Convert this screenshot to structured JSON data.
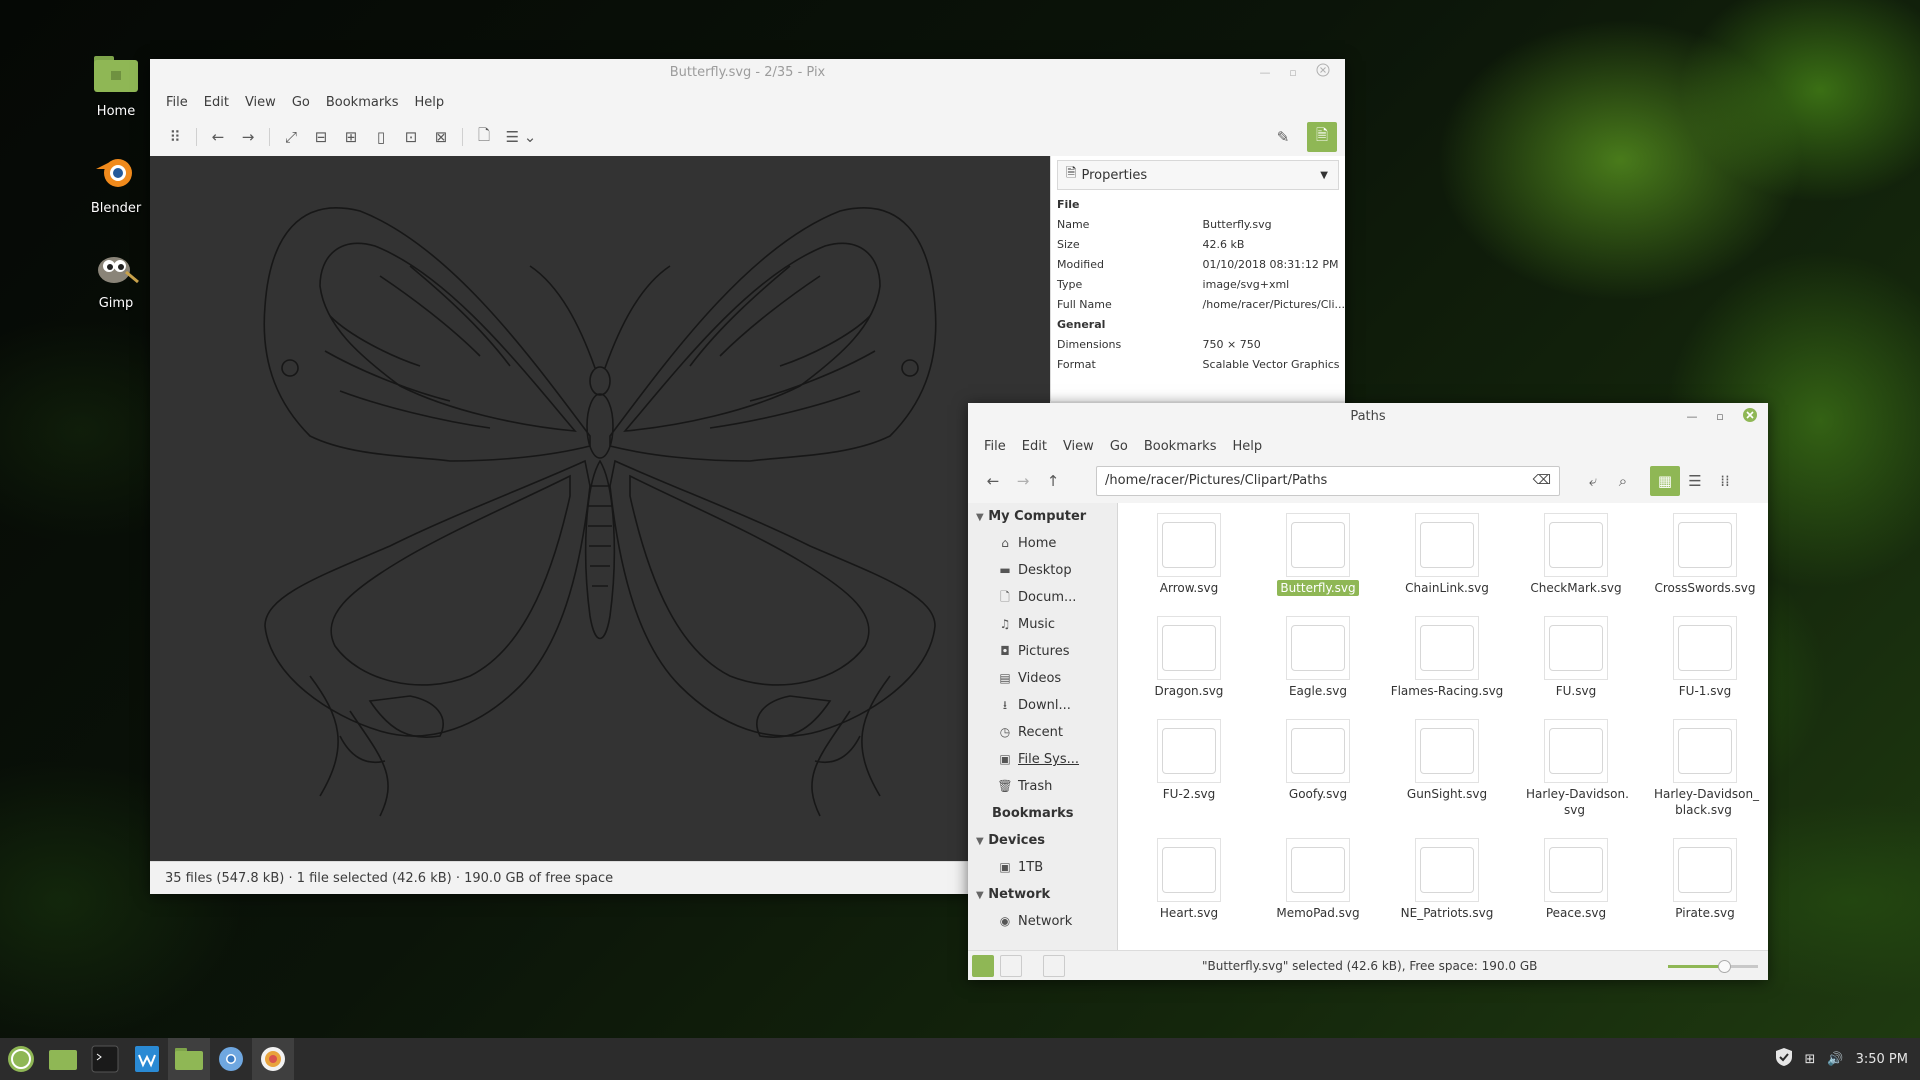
{
  "desktop": {
    "icons": [
      {
        "label": "Home",
        "icon": "home-folder-icon"
      },
      {
        "label": "Blender",
        "icon": "blender-icon"
      },
      {
        "label": "Gimp",
        "icon": "gimp-icon"
      }
    ]
  },
  "pix": {
    "title": "Butterfly.svg - 2/35 - Pix",
    "menu": [
      "File",
      "Edit",
      "View",
      "Go",
      "Bookmarks",
      "Help"
    ],
    "status": "35 files (547.8 kB) · 1 file selected (42.6 kB) · 190.0 GB of free space",
    "properties": {
      "header": "Properties",
      "rows": [
        {
          "section": "File"
        },
        {
          "key": "Name",
          "value": "Butterfly.svg"
        },
        {
          "key": "Size",
          "value": "42.6 kB"
        },
        {
          "key": "Modified",
          "value": "01/10/2018 08:31:12 PM"
        },
        {
          "key": "Type",
          "value": "image/svg+xml"
        },
        {
          "key": "Full Name",
          "value": "/home/racer/Pictures/Cli..."
        },
        {
          "section": "General"
        },
        {
          "key": "Dimensions",
          "value": "750 × 750"
        },
        {
          "key": "Format",
          "value": "Scalable Vector Graphics"
        }
      ]
    }
  },
  "nemo": {
    "title": "Paths",
    "menu": [
      "File",
      "Edit",
      "View",
      "Go",
      "Bookmarks",
      "Help"
    ],
    "path": "/home/racer/Pictures/Clipart/Paths",
    "sidebar": {
      "my_computer": "My Computer",
      "items": [
        {
          "label": "Home",
          "icon": "home-icon"
        },
        {
          "label": "Desktop",
          "icon": "desktop-icon"
        },
        {
          "label": "Docum...",
          "icon": "documents-icon"
        },
        {
          "label": "Music",
          "icon": "music-icon"
        },
        {
          "label": "Pictures",
          "icon": "camera-icon"
        },
        {
          "label": "Videos",
          "icon": "film-icon"
        },
        {
          "label": "Downl...",
          "icon": "download-icon"
        },
        {
          "label": "Recent",
          "icon": "clock-icon"
        },
        {
          "label": "File Sys...",
          "icon": "drive-icon"
        },
        {
          "label": "Trash",
          "icon": "trash-icon"
        }
      ],
      "bookmarks": "Bookmarks",
      "devices": "Devices",
      "device_items": [
        {
          "label": "1TB",
          "icon": "drive-icon"
        }
      ],
      "network": "Network",
      "network_items": [
        {
          "label": "Network",
          "icon": "network-icon"
        }
      ]
    },
    "files": [
      "Arrow.svg",
      "Butterfly.svg",
      "ChainLink.svg",
      "CheckMark.svg",
      "CrossSwords.svg",
      "Dragon.svg",
      "Eagle.svg",
      "Flames-Racing.svg",
      "FU.svg",
      "FU-1.svg",
      "FU-2.svg",
      "Goofy.svg",
      "GunSight.svg",
      "Harley-Davidson.\nsvg",
      "Harley-Davidson_\nblack.svg",
      "Heart.svg",
      "MemoPad.svg",
      "NE_Patriots.svg",
      "Peace.svg",
      "Pirate.svg"
    ],
    "selected_file": "Butterfly.svg",
    "status": "\"Butterfly.svg\" selected (42.6 kB), Free space: 190.0 GB",
    "zoom_level": 0.62
  },
  "taskbar": {
    "apps": [
      {
        "name": "mint-menu-icon"
      },
      {
        "name": "show-desktop-icon"
      },
      {
        "name": "terminal-icon"
      },
      {
        "name": "writer-icon"
      },
      {
        "name": "files-icon"
      },
      {
        "name": "chromium-icon"
      },
      {
        "name": "pix-icon"
      }
    ],
    "clock": "3:50 PM"
  },
  "colors": {
    "accent": "#8fb755",
    "viewer_bg": "#333333",
    "taskbar": "#2c2c2c"
  }
}
